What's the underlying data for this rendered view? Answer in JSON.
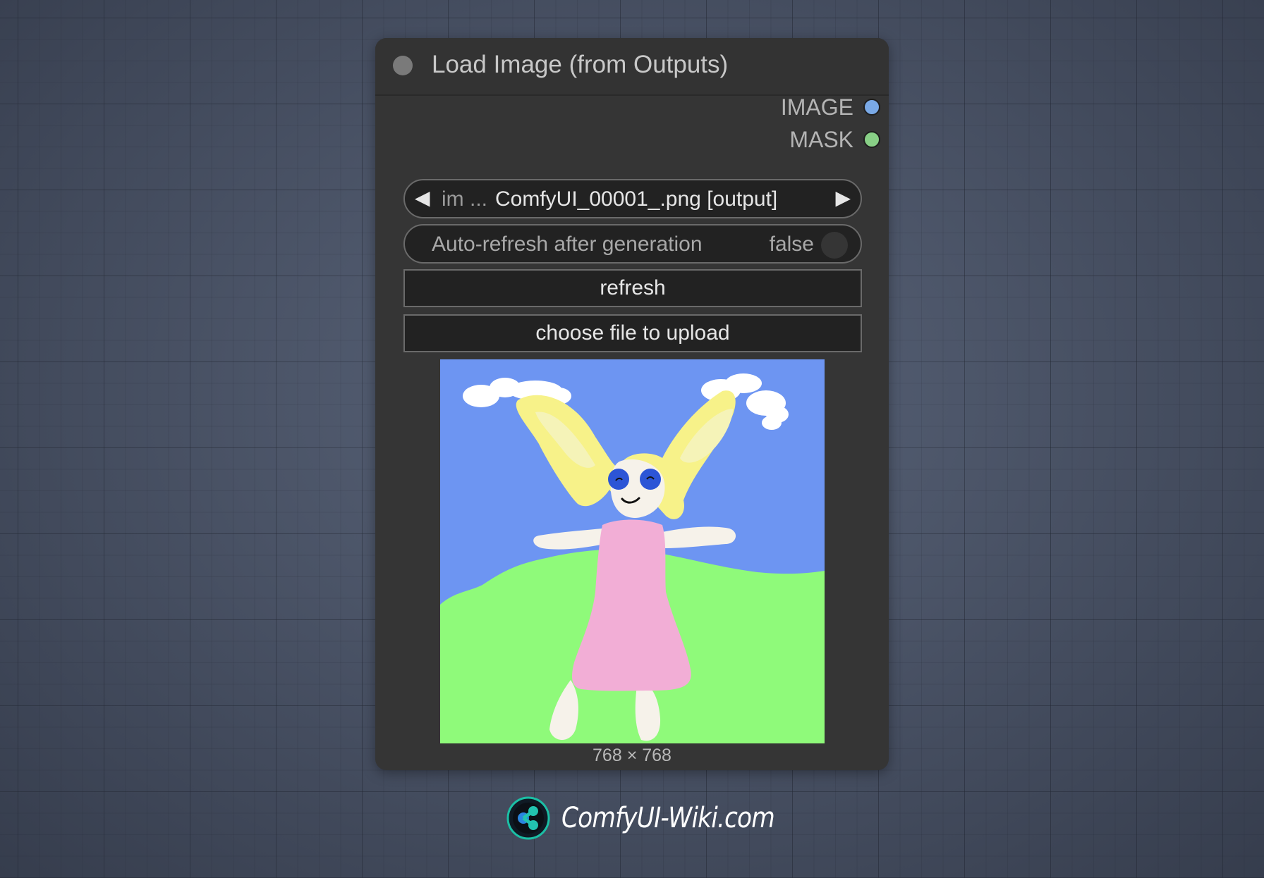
{
  "node": {
    "title": "Load Image (from Outputs)",
    "outputs": [
      {
        "label": "IMAGE",
        "color": "#7aa9e6"
      },
      {
        "label": "MASK",
        "color": "#88cf86"
      }
    ],
    "image_widget": {
      "name": "im ...",
      "value": "ComfyUI_00001_.png [output]",
      "left_arrow": "◀",
      "right_arrow": "▶"
    },
    "auto_refresh": {
      "label": "Auto-refresh after generation",
      "value": "false"
    },
    "refresh_button": "refresh",
    "upload_button": "choose file to upload",
    "preview": {
      "dimensions": "768 × 768"
    }
  },
  "brand": {
    "text": "ComfyUI-Wiki.com"
  },
  "colors": {
    "node_bg": "#353535",
    "canvas_bg": "#4a5366",
    "image_output": "#7aa9e6",
    "mask_output": "#88cf86"
  }
}
